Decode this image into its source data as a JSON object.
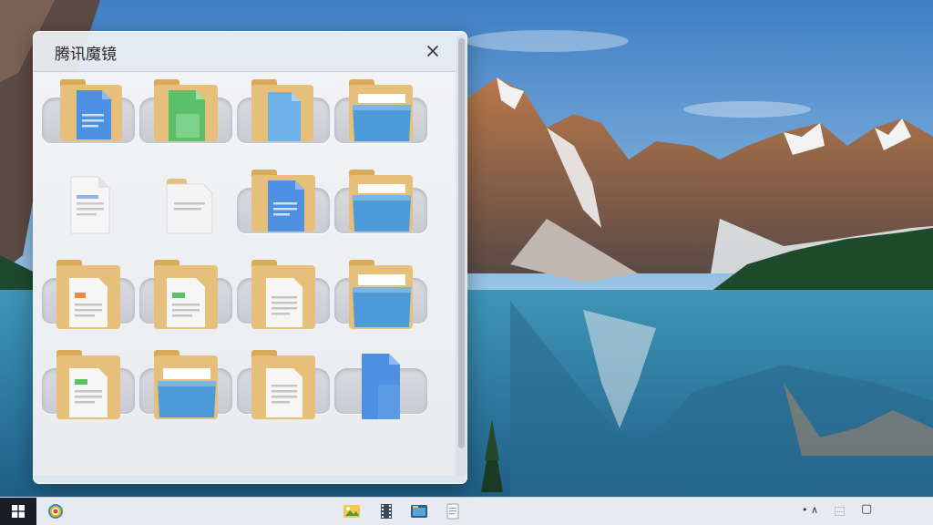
{
  "window": {
    "title": "腾讯魔镜",
    "close_glyph": "✕"
  },
  "grid": {
    "items": [
      {
        "icon": "folder-doc-blue-icon"
      },
      {
        "icon": "folder-doc-green-icon"
      },
      {
        "icon": "folder-doc-lightblue-icon"
      },
      {
        "icon": "folder-open-blue-icon"
      },
      {
        "icon": "document-icon"
      },
      {
        "icon": "document-small-icon"
      },
      {
        "icon": "folder-doc-blue-icon"
      },
      {
        "icon": "folder-open-blue-icon"
      },
      {
        "icon": "folder-doc-orange-icon"
      },
      {
        "icon": "folder-doc-green-icon"
      },
      {
        "icon": "folder-doc-gray-icon"
      },
      {
        "icon": "folder-open-blue-icon"
      },
      {
        "icon": "folder-doc-green-icon"
      },
      {
        "icon": "folder-open-blue-icon"
      },
      {
        "icon": "folder-doc-gray-icon"
      },
      {
        "icon": "blue-document-icon"
      }
    ]
  },
  "taskbar": {
    "start_icon": "windows-logo-icon",
    "apps": [
      "browser-icon",
      "gallery-icon",
      "film-icon",
      "folder-app-icon",
      "notepad-icon"
    ],
    "tray": {
      "dot": "•",
      "chevron": "∧",
      "ime": "⿱",
      "desktop": "▢"
    }
  },
  "colors": {
    "folder": "#e6c07a",
    "folder_dark": "#d4a85c",
    "doc_blue": "#4d8fe0",
    "doc_green": "#5cc06a",
    "doc_light": "#6cb1e8",
    "accent_orange": "#ef8a3a"
  }
}
